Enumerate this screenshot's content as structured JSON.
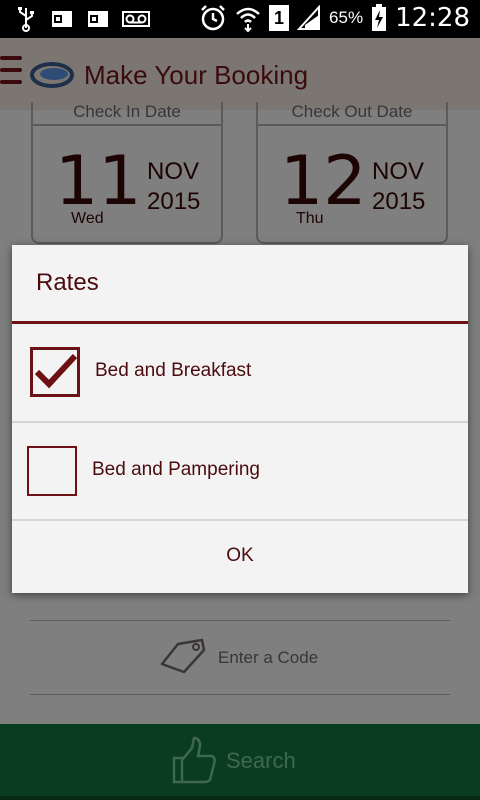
{
  "status_bar": {
    "battery": "65%",
    "time": "12:28",
    "sim_slot": "1",
    "icons": [
      "usb-icon",
      "outlook-icon",
      "outlook-icon",
      "voicemail-icon",
      "alarm-icon",
      "wifi-icon",
      "sim-icon",
      "signal-icon",
      "battery-charging-icon"
    ]
  },
  "app_bar": {
    "title": "Make Your Booking",
    "icons": [
      "menu-icon",
      "logo-icon"
    ]
  },
  "check_in": {
    "label": "Check In Date",
    "day": "11",
    "month": "NOV",
    "year": "2015",
    "weekday": "Wed"
  },
  "check_out": {
    "label": "Check Out Date",
    "day": "12",
    "month": "NOV",
    "year": "2015",
    "weekday": "Thu"
  },
  "promo": {
    "placeholder": "Enter a Code",
    "icon": "tag-icon"
  },
  "search": {
    "label": "Search",
    "icon": "thumbs-up-icon"
  },
  "dialog": {
    "title": "Rates",
    "options": [
      {
        "label": "Bed and Breakfast",
        "checked": true
      },
      {
        "label": "Bed and Pampering",
        "checked": false
      }
    ],
    "ok_label": "OK"
  },
  "colors": {
    "accent": "#6d1214",
    "search_bar": "#0a3c1f",
    "dialog_bg": "#f3f3f3"
  }
}
